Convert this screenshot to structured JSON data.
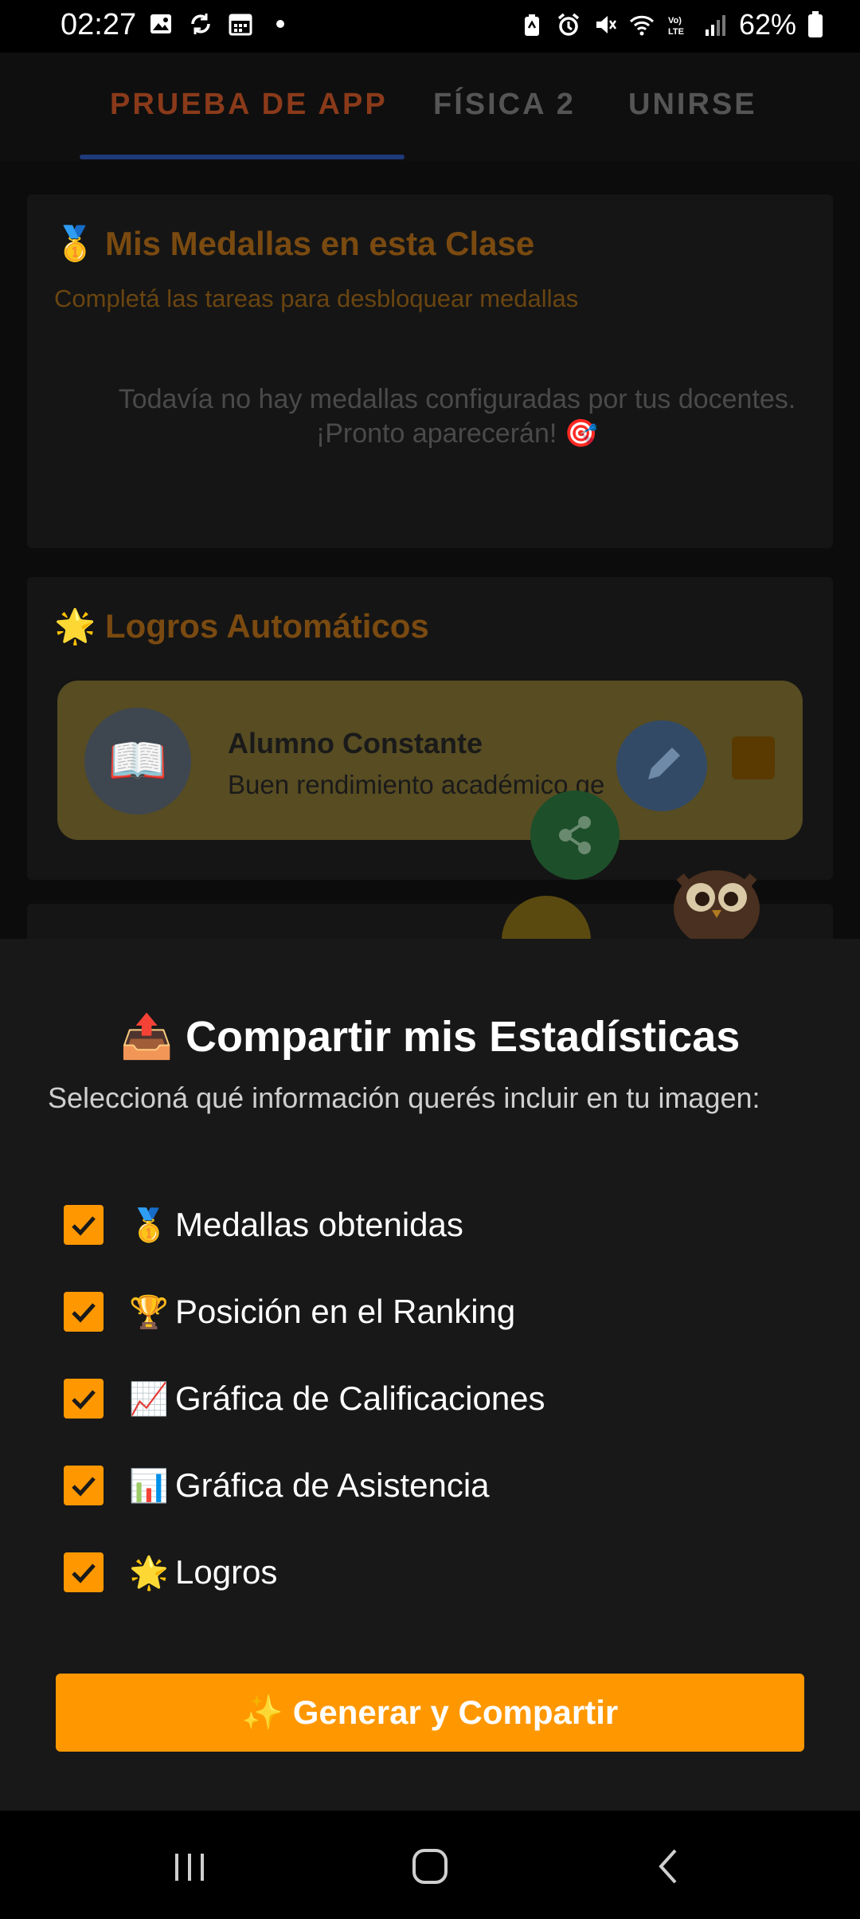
{
  "status_bar": {
    "time": "02:27",
    "battery": "62%"
  },
  "tabs": [
    {
      "label": "PRUEBA DE APP"
    },
    {
      "label": "FÍSICA 2"
    },
    {
      "label": "UNIRSE"
    }
  ],
  "medals_card": {
    "icon": "🥇",
    "title": "Mis Medallas en esta Clase",
    "subtitle": "Completá las tareas para desbloquear medallas",
    "empty_line1": "Todavía no hay medallas configuradas por tus docentes.",
    "empty_line2": "¡Pronto aparecerán! 🎯"
  },
  "achievements_card": {
    "icon": "🌟",
    "title": "Logros Automáticos",
    "item": {
      "icon": "📖",
      "title": "Alumno Constante",
      "description": "Buen rendimiento académico ge"
    }
  },
  "share_sheet": {
    "icon": "📤",
    "title": "Compartir mis Estadísticas",
    "description": "Seleccioná qué información querés incluir en tu imagen:",
    "options": [
      {
        "emoji": "🥇",
        "label": "Medallas obtenidas",
        "checked": true
      },
      {
        "emoji": "🏆",
        "label": "Posición en el Ranking",
        "checked": true
      },
      {
        "emoji": "📈",
        "label": "Gráfica de Calificaciones",
        "checked": true
      },
      {
        "emoji": "📊",
        "label": "Gráfica de Asistencia",
        "checked": true
      },
      {
        "emoji": "🌟",
        "label": "Logros",
        "checked": true
      }
    ],
    "button_icon": "✨",
    "button_label": "Generar y Compartir"
  },
  "colors": {
    "accent": "#ff9800",
    "sheet_bg": "#181818"
  }
}
